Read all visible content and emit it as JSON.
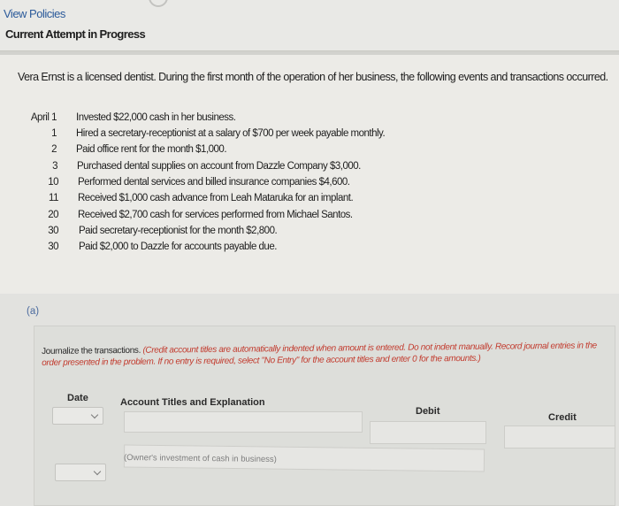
{
  "header": {
    "view_policies": "View Policies",
    "attempt_status": "Current Attempt in Progress"
  },
  "problem": {
    "intro": "Vera Ernst is a licensed dentist. During the first month of the operation of her business, the following events and transactions occurred.",
    "transactions": [
      {
        "date": "April 1",
        "description": "Invested $22,000 cash in her business."
      },
      {
        "date": "1",
        "description": "Hired a secretary-receptionist at a salary of $700 per week payable monthly."
      },
      {
        "date": "2",
        "description": "Paid office rent for the month $1,000."
      },
      {
        "date": "3",
        "description": "Purchased dental supplies on account from Dazzle Company $3,000."
      },
      {
        "date": "10",
        "description": "Performed dental services and billed insurance companies $4,600."
      },
      {
        "date": "11",
        "description": "Received $1,000 cash advance from Leah Mataruka for an implant."
      },
      {
        "date": "20",
        "description": "Received $2,700 cash for services performed from Michael Santos."
      },
      {
        "date": "30",
        "description": "Paid secretary-receptionist for the month $2,800."
      },
      {
        "date": "30",
        "description": "Paid $2,000 to Dazzle for accounts payable due."
      }
    ]
  },
  "part": {
    "label": "(a)",
    "instructions_plain": "Journalize the transactions.",
    "instructions_note": "(Credit account titles are automatically indented when amount is entered. Do not indent manually. Record journal entries in the order presented in the problem. If no entry is required, select \"No Entry\" for the account titles and enter 0 for the amounts.)"
  },
  "table": {
    "headers": {
      "date": "Date",
      "account": "Account Titles and Explanation",
      "debit": "Debit",
      "credit": "Credit"
    },
    "rows": [
      {
        "date": "",
        "account": "",
        "debit": "",
        "credit": ""
      },
      {
        "date": "",
        "explanation": "(Owner's investment of cash in business)"
      }
    ]
  }
}
